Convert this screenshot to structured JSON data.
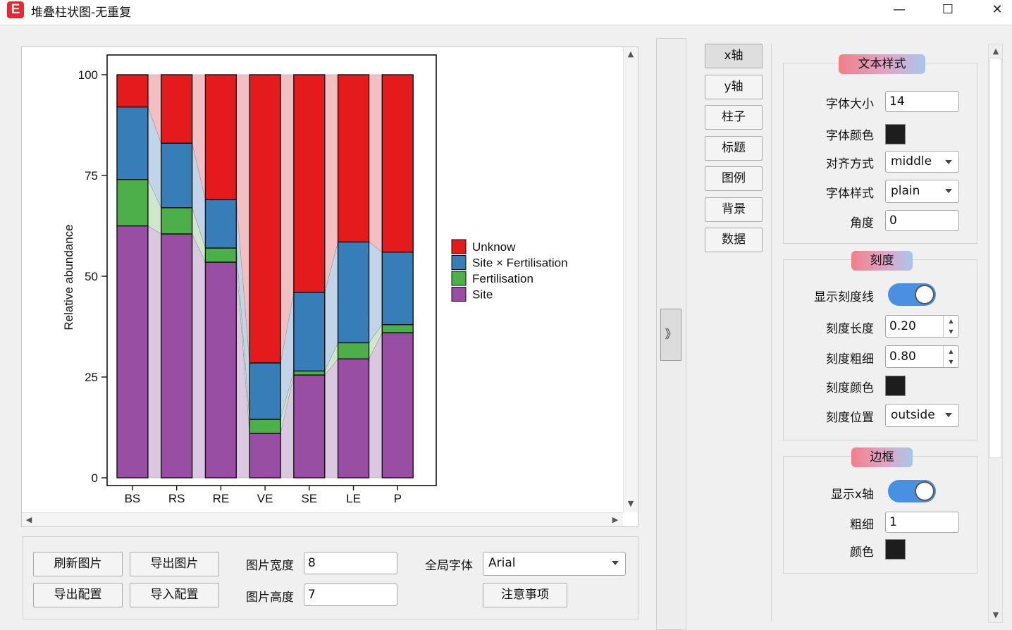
{
  "window": {
    "title": "堆叠柱状图-无重复",
    "logo_letter": "E",
    "minimize": "—",
    "maximize": "☐",
    "close": "✕"
  },
  "chart_data": {
    "type": "bar",
    "stacked": true,
    "categories": [
      "BS",
      "RS",
      "RE",
      "VE",
      "SE",
      "LE",
      "P"
    ],
    "series": [
      {
        "name": "Site",
        "color": "#984ea3",
        "values": [
          62.5,
          60.5,
          53.5,
          11,
          25.5,
          29.5,
          36
        ]
      },
      {
        "name": "Fertilisation",
        "color": "#4daf4a",
        "values": [
          11.5,
          6.5,
          3.5,
          3.5,
          1,
          4,
          2
        ]
      },
      {
        "name": "Site × Fertilisation",
        "color": "#377eb8",
        "values": [
          18,
          16,
          12,
          14,
          19.5,
          25,
          18
        ]
      },
      {
        "name": "Unknow",
        "color": "#e41a1c",
        "values": [
          8,
          17,
          31,
          71.5,
          54,
          41.5,
          44
        ]
      }
    ],
    "ylabel": "Relative abundance",
    "xlabel": "",
    "ylim": [
      0,
      100
    ],
    "yticks": [
      "0",
      "25",
      "50",
      "75",
      "100"
    ],
    "legend_position": "right",
    "grid": false,
    "band_colors": [
      "#dac8e0",
      "#cfe8cd",
      "#c2d5e8",
      "#f2bfc2"
    ]
  },
  "bottom": {
    "refresh_label": "刷新图片",
    "export_image_label": "导出图片",
    "export_config_label": "导出配置",
    "import_config_label": "导入配置",
    "width_label": "图片宽度",
    "width_value": "8",
    "height_label": "图片高度",
    "height_value": "7",
    "font_label": "全局字体",
    "font_value": "Arial",
    "notes_label": "注意事项"
  },
  "collapse_arrow": "》",
  "nav": [
    "x轴",
    "y轴",
    "柱子",
    "标题",
    "图例",
    "背景",
    "数据"
  ],
  "text_style": {
    "title": "文本样式",
    "font_size_label": "字体大小",
    "font_size_value": "14",
    "font_color_label": "字体颜色",
    "font_color": "#1d1d1d",
    "align_label": "对齐方式",
    "align_value": "middle",
    "style_label": "字体样式",
    "style_value": "plain",
    "angle_label": "角度",
    "angle_value": "0"
  },
  "ticks": {
    "title": "刻度",
    "show_label": "显示刻度线",
    "show_on": true,
    "length_label": "刻度长度",
    "length_value": "0.20",
    "thickness_label": "刻度粗细",
    "thickness_value": "0.80",
    "color_label": "刻度颜色",
    "color": "#1d1d1d",
    "position_label": "刻度位置",
    "position_value": "outside"
  },
  "border": {
    "title": "边框",
    "show_label": "显示x轴",
    "show_on": true,
    "thickness_label": "粗细",
    "thickness_value": "1",
    "color_label": "颜色",
    "color": "#1d1d1d"
  }
}
